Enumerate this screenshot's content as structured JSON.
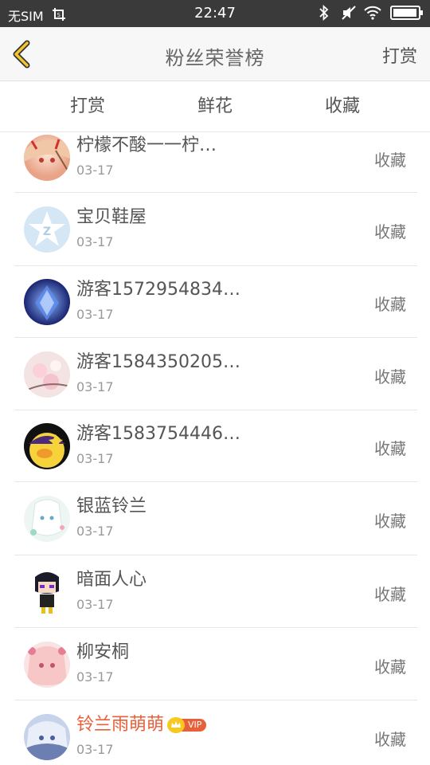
{
  "status_bar": {
    "carrier": "无SIM",
    "time": "22:47",
    "icons": [
      "screenshot-icon",
      "bluetooth-icon",
      "mute-icon",
      "wifi-icon",
      "battery-icon"
    ],
    "battery_level": 0.95
  },
  "header": {
    "title": "粉丝荣誉榜",
    "action_label": "打赏"
  },
  "tabs": [
    {
      "label": "打赏",
      "active": false
    },
    {
      "label": "鲜花",
      "active": false
    },
    {
      "label": "收藏",
      "active": true
    }
  ],
  "colors": {
    "accent": "#f0a020",
    "vip_name": "#e8603a",
    "status_bar_bg": "#3a3a3a"
  },
  "fans": [
    {
      "name": "柠檬不酸一一柠…",
      "date": "03-17",
      "action": "收藏",
      "avatar": "anime-girl-red-avatar"
    },
    {
      "name": "宝贝鞋屋",
      "date": "03-17",
      "action": "收藏",
      "avatar": "default-z-avatar"
    },
    {
      "name": "游客1572954834…",
      "date": "03-17",
      "action": "收藏",
      "avatar": "blue-crystal-avatar"
    },
    {
      "name": "游客1584350205…",
      "date": "03-17",
      "action": "收藏",
      "avatar": "pink-flowers-avatar"
    },
    {
      "name": "游客1583754446…",
      "date": "03-17",
      "action": "收藏",
      "avatar": "yellow-chick-avatar"
    },
    {
      "name": "银蓝铃兰",
      "date": "03-17",
      "action": "收藏",
      "avatar": "anime-girl-white-avatar"
    },
    {
      "name": "暗面人心",
      "date": "03-17",
      "action": "收藏",
      "avatar": "chibi-dark-avatar"
    },
    {
      "name": "柳安桐",
      "date": "03-17",
      "action": "收藏",
      "avatar": "anime-girl-pink-avatar"
    },
    {
      "name": "铃兰雨萌萌",
      "date": "03-17",
      "action": "收藏",
      "avatar": "anime-girl-blue-avatar",
      "vip": true,
      "vip_label": "VIP"
    }
  ]
}
